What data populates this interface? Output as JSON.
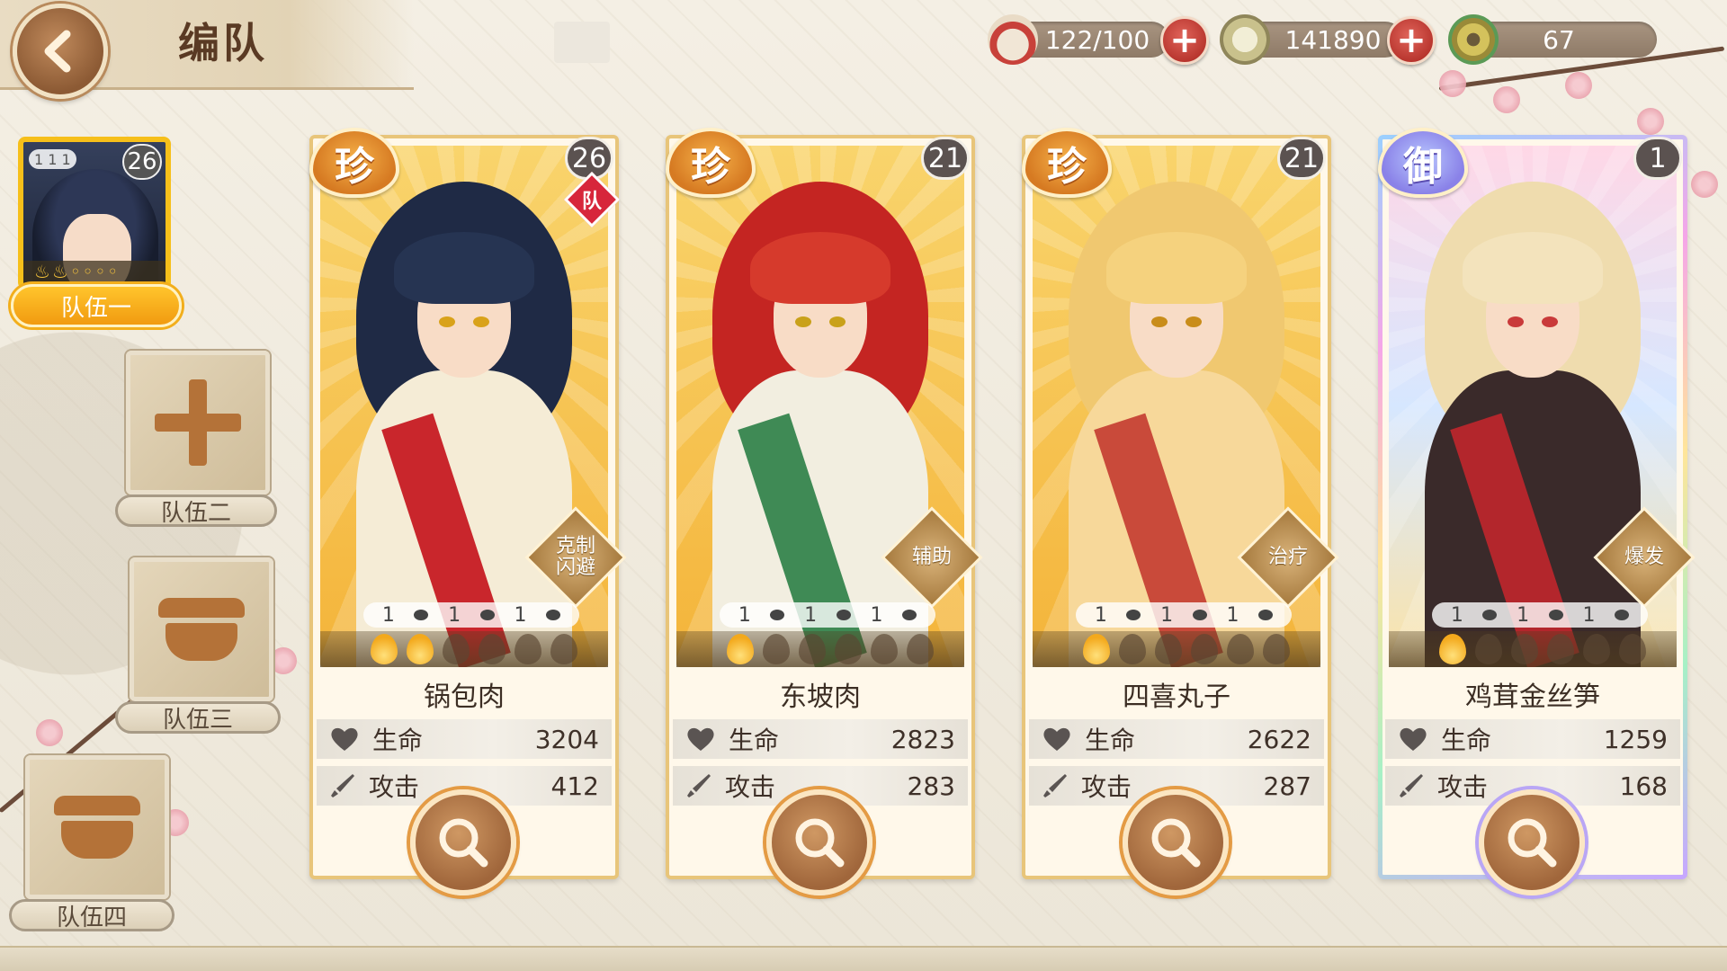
{
  "header": {
    "title": "编队"
  },
  "currencies": [
    {
      "icon": "rice-bowl-icon",
      "value": "122/100"
    },
    {
      "icon": "coin-icon",
      "value": "141890"
    },
    {
      "icon": "jade-coin-icon",
      "value": "67"
    }
  ],
  "teams": {
    "active": {
      "label": "队伍一",
      "level": "26",
      "mini_stats": "1 1 1"
    },
    "others": [
      {
        "label": "队伍二",
        "state": "add"
      },
      {
        "label": "队伍三",
        "state": "locked"
      },
      {
        "label": "队伍四",
        "state": "locked"
      }
    ]
  },
  "cards": [
    {
      "rarity": "珍",
      "level": "26",
      "team_tag": "队",
      "role": "克制\n闪避",
      "skills": [
        "1",
        "1",
        "1"
      ],
      "flames_on": 2,
      "flames_total": 6,
      "name": "锅包肉",
      "hp_label": "生命",
      "hp": "3204",
      "atk_label": "攻击",
      "atk": "412"
    },
    {
      "rarity": "珍",
      "level": "21",
      "team_tag": "",
      "role": "辅助",
      "skills": [
        "1",
        "1",
        "1"
      ],
      "flames_on": 1,
      "flames_total": 6,
      "name": "东坡肉",
      "hp_label": "生命",
      "hp": "2823",
      "atk_label": "攻击",
      "atk": "283"
    },
    {
      "rarity": "珍",
      "level": "21",
      "team_tag": "",
      "role": "治疗",
      "skills": [
        "1",
        "1",
        "1"
      ],
      "flames_on": 1,
      "flames_total": 6,
      "name": "四喜丸子",
      "hp_label": "生命",
      "hp": "2622",
      "atk_label": "攻击",
      "atk": "287"
    },
    {
      "rarity": "御",
      "level": "1",
      "team_tag": "",
      "role": "爆发",
      "skills": [
        "1",
        "1",
        "1"
      ],
      "flames_on": 1,
      "flames_total": 6,
      "name": "鸡茸金丝笋",
      "hp_label": "生命",
      "hp": "1259",
      "atk_label": "攻击",
      "atk": "168"
    }
  ],
  "colors": {
    "accent_gold": "#f6bf1a",
    "button_brown": "#a0663b",
    "plus_red": "#c83a32"
  }
}
